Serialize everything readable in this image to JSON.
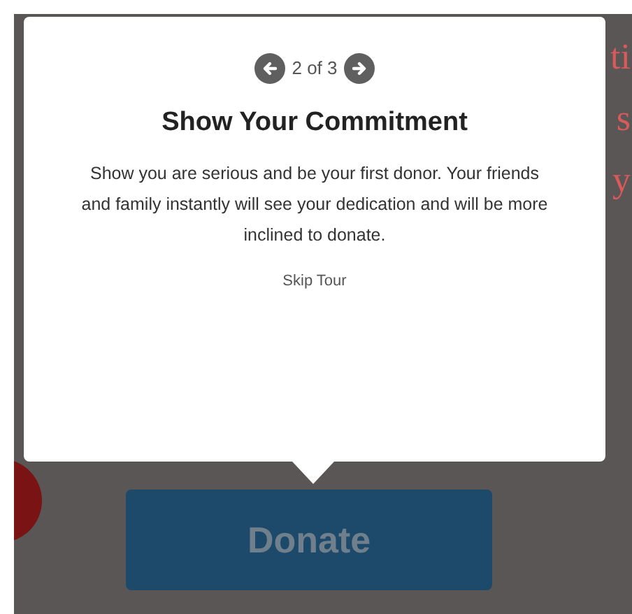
{
  "background": {
    "text_fragments": [
      "ti",
      "s",
      "y"
    ],
    "donate_button": "Donate"
  },
  "tour": {
    "step": "2 of 3",
    "title": "Show Your Commitment",
    "body": "Show you are serious and be your first donor. Your friends and family instantly will see your dedication and will be more inclined to donate.",
    "skip": "Skip Tour"
  }
}
